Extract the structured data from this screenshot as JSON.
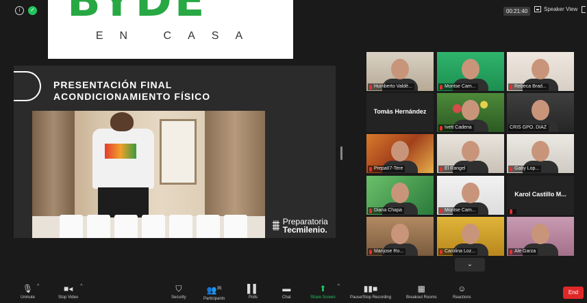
{
  "topbar": {
    "timer": "00:21:40",
    "speaker_view_label": "Speaker View",
    "icons": [
      "info-icon",
      "shield-icon",
      "grid-icon",
      "fullscreen-icon"
    ],
    "accent_green": "#23c45e"
  },
  "logo": {
    "headline": "BYDE",
    "subline": "EN CASA",
    "color": "#27a843"
  },
  "presentation": {
    "title_line1": "PRESENTACIÓN FINAL",
    "title_line2": "ACONDICIONAMIENTO FÍSICO",
    "brand_line1": "Preparatoria",
    "brand_line2": "Tecmilenio."
  },
  "gallery": {
    "tiles": [
      {
        "name": "Humberto Valdé...",
        "muted": true
      },
      {
        "name": "Montse Cam...",
        "muted": true
      },
      {
        "name": "Rebeca Brad...",
        "muted": true
      },
      {
        "name": "",
        "display": "Tomás Hernández",
        "muted": false
      },
      {
        "name": "Ivett Cadena",
        "muted": true
      },
      {
        "name": "CRIS GPO. DIAZ",
        "muted": false,
        "active": true
      },
      {
        "name": "PrepaII7-Tere",
        "muted": true
      },
      {
        "name": "El Rangel",
        "muted": true
      },
      {
        "name": "Gaby Lop...",
        "muted": true
      },
      {
        "name": "Diana Chapa",
        "muted": true
      },
      {
        "name": "Montse Cam...",
        "muted": true
      },
      {
        "name": "",
        "display": "Karol Castillo M...",
        "muted": true
      },
      {
        "name": "Marijose Ro...",
        "muted": true
      },
      {
        "name": "Carolina Loz...",
        "muted": true
      },
      {
        "name": "Ale Garza",
        "muted": true
      }
    ],
    "more_label": "⌄"
  },
  "toolbar": {
    "unmute": "Unmute",
    "stop_video": "Stop Video",
    "security": "Security",
    "participants": "Participants",
    "participants_count": "35",
    "polls": "Polls",
    "chat": "Chat",
    "share_screen": "Share Screen",
    "recording": "Pause/Stop Recording",
    "breakout": "Breakout Rooms",
    "reactions": "Reactions",
    "end": "End",
    "end_color": "#e02828"
  }
}
